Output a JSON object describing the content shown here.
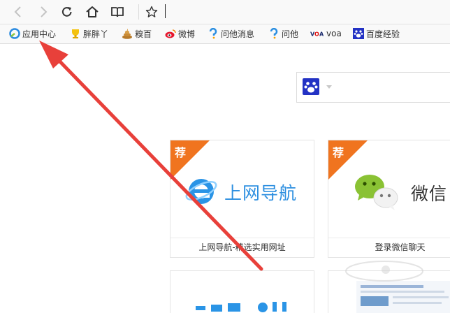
{
  "toolbar": {
    "back_icon": "chevron-left-icon",
    "forward_icon": "chevron-right-icon",
    "reload_icon": "reload-icon",
    "home_icon": "home-icon",
    "reader_icon": "book-icon",
    "favorite_icon": "star-icon",
    "address_value": ""
  },
  "bookmarks": [
    {
      "label": "应用中心",
      "icon": "app-center-icon"
    },
    {
      "label": "胖胖丫",
      "icon": "trophy-icon"
    },
    {
      "label": "糗百",
      "icon": "poop-icon"
    },
    {
      "label": "微博",
      "icon": "weibo-icon"
    },
    {
      "label": "问他消息",
      "icon": "wenta-icon"
    },
    {
      "label": "问他",
      "icon": "wenta-icon"
    },
    {
      "label": "voa",
      "icon": "voa-icon"
    },
    {
      "label": "百度经验",
      "icon": "baidu-paw-icon"
    }
  ],
  "search": {
    "engine_icon": "baidu-paw-icon",
    "value": ""
  },
  "tiles": [
    {
      "badge": "荐",
      "logo_text": "上网导航",
      "caption": "上网导航-精选实用网址"
    },
    {
      "badge": "荐",
      "logo_text": "微信",
      "caption": "登录微信聊天"
    }
  ],
  "annotation": {
    "color": "#e8403a"
  }
}
